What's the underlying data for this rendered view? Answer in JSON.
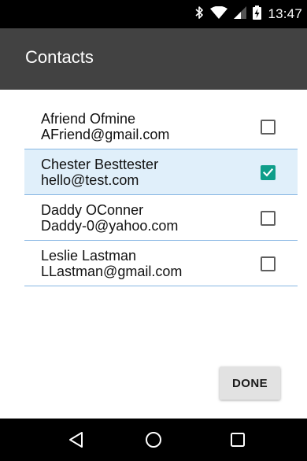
{
  "status_bar": {
    "time": "13:47",
    "icons": [
      "bluetooth-icon",
      "wifi-icon",
      "signal-icon",
      "battery-charging-icon"
    ]
  },
  "app_bar": {
    "title": "Contacts"
  },
  "contacts": [
    {
      "name": "Afriend Ofmine",
      "email": "AFriend@gmail.com",
      "checked": false
    },
    {
      "name": "Chester Besttester",
      "email": "hello@test.com",
      "checked": true
    },
    {
      "name": "Daddy OConner",
      "email": "Daddy-0@yahoo.com",
      "checked": false
    },
    {
      "name": "Leslie Lastman",
      "email": "LLastman@gmail.com",
      "checked": false
    }
  ],
  "done_button": {
    "label": "DONE"
  },
  "nav_bar": {
    "buttons": [
      "back-icon",
      "home-icon",
      "recents-icon"
    ]
  },
  "colors": {
    "app_bar": "#424242",
    "selected_row": "#e0effa",
    "divider": "#86b6e3",
    "check_accent": "#0f9e8a"
  }
}
